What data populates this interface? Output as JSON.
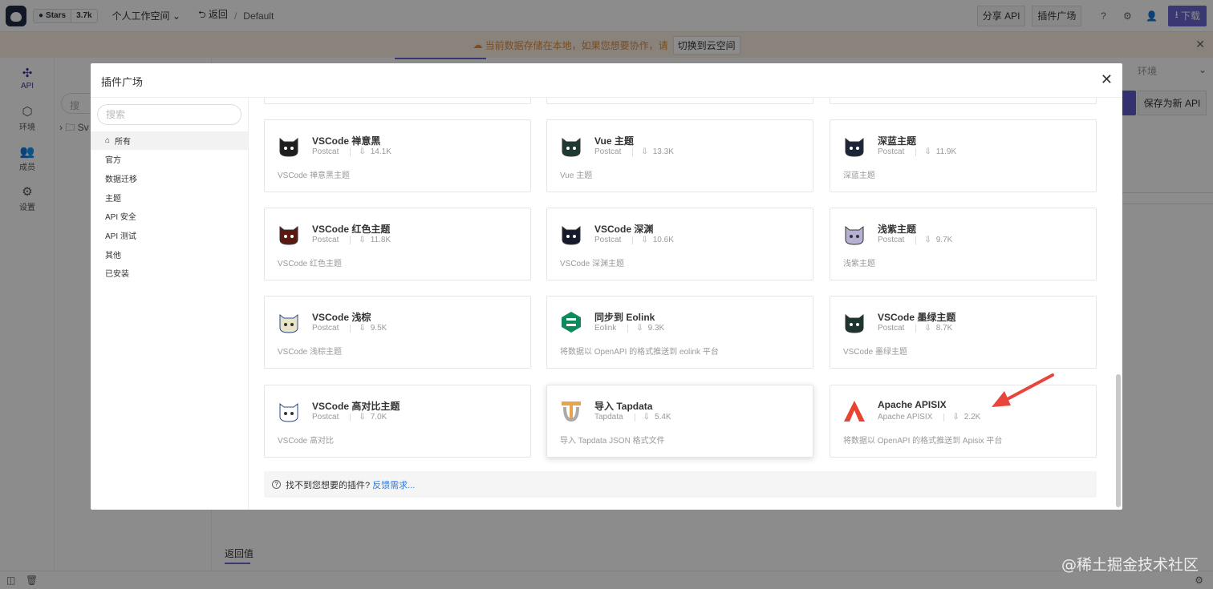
{
  "app": {
    "github_stars_label": "Stars",
    "github_stars_count": "3.7k",
    "workspace": "个人工作空间",
    "back_label": "返回",
    "breadcrumb": "Default",
    "share_api": "分享 API",
    "plugin_market": "插件广场",
    "download": "下载"
  },
  "banner": {
    "text": "当前数据存储在本地，如果您想要协作，请",
    "switch_label": "切换到云空间"
  },
  "leftnav": [
    {
      "label": "API",
      "icon": "api-icon"
    },
    {
      "label": "环境",
      "icon": "environment-icon"
    },
    {
      "label": "成员",
      "icon": "members-icon"
    },
    {
      "label": "设置",
      "icon": "settings-icon"
    }
  ],
  "tree": {
    "search_placeholder": "搜",
    "node": "Sv"
  },
  "main": {
    "env_label": "环境",
    "save_as_new": "保存为新 API",
    "return_value_tab": "返回值"
  },
  "modal": {
    "title": "插件广场",
    "search_placeholder": "搜索",
    "categories": [
      "所有",
      "官方",
      "数据迁移",
      "主题",
      "API 安全",
      "API 测试",
      "其他",
      "已安装"
    ],
    "plugins": [
      {
        "name": "VSCode 禅意黑",
        "author": "Postcat",
        "downloads": "14.1K",
        "desc": "VSCode 禅意黑主题",
        "icon": "cat-icon",
        "color": "#1e1e1e"
      },
      {
        "name": "Vue 主题",
        "author": "Postcat",
        "downloads": "13.3K",
        "desc": "Vue 主题",
        "icon": "cat-icon",
        "color": "#1f3a33"
      },
      {
        "name": "深蓝主题",
        "author": "Postcat",
        "downloads": "11.9K",
        "desc": "深蓝主题",
        "icon": "cat-icon",
        "color": "#1c2438"
      },
      {
        "name": "VSCode 红色主题",
        "author": "Postcat",
        "downloads": "11.8K",
        "desc": "VSCode 红色主题",
        "icon": "cat-icon",
        "color": "#5a1a12"
      },
      {
        "name": "VSCode 深渊",
        "author": "Postcat",
        "downloads": "10.6K",
        "desc": "VSCode 深渊主题",
        "icon": "cat-icon",
        "color": "#151a2c"
      },
      {
        "name": "浅紫主题",
        "author": "Postcat",
        "downloads": "9.7K",
        "desc": "浅紫主题",
        "icon": "cat-icon",
        "color": "#b6b0d4"
      },
      {
        "name": "VSCode 浅棕",
        "author": "Postcat",
        "downloads": "9.5K",
        "desc": "VSCode 浅棕主题",
        "icon": "cat-icon",
        "color": "#e9e4c8"
      },
      {
        "name": "同步到 Eolink",
        "author": "Eolink",
        "downloads": "9.3K",
        "desc": "将数据以 OpenAPI 的格式推送到 eolink 平台",
        "icon": "eolink-icon",
        "color": "#0f8a5a"
      },
      {
        "name": "VSCode 墨绿主题",
        "author": "Postcat",
        "downloads": "8.7K",
        "desc": "VSCode 墨绿主题",
        "icon": "cat-icon",
        "color": "#1c3530"
      },
      {
        "name": "VSCode 高对比主题",
        "author": "Postcat",
        "downloads": "7.0K",
        "desc": "VSCode 高对比",
        "icon": "cat-icon",
        "color": "#ffffff"
      },
      {
        "name": "导入 Tapdata",
        "author": "Tapdata",
        "downloads": "5.4K",
        "desc": "导入 Tapdata JSON 格式文件",
        "icon": "tapdata-icon",
        "color": "#e8a44a"
      },
      {
        "name": "Apache APISIX",
        "author": "Apache APISIX",
        "downloads": "2.2K",
        "desc": "将数据以 OpenAPI 的格式推送到 Apisix 平台",
        "icon": "apisix-icon",
        "color": "#e8432e"
      }
    ],
    "help_text": "找不到您想要的插件?",
    "help_link": "反馈需求..."
  },
  "watermark": "@稀土掘金技术社区",
  "colors": {
    "accent": "#6a67cf",
    "arrow": "#e8453c",
    "banner_text": "#e08a3a"
  }
}
